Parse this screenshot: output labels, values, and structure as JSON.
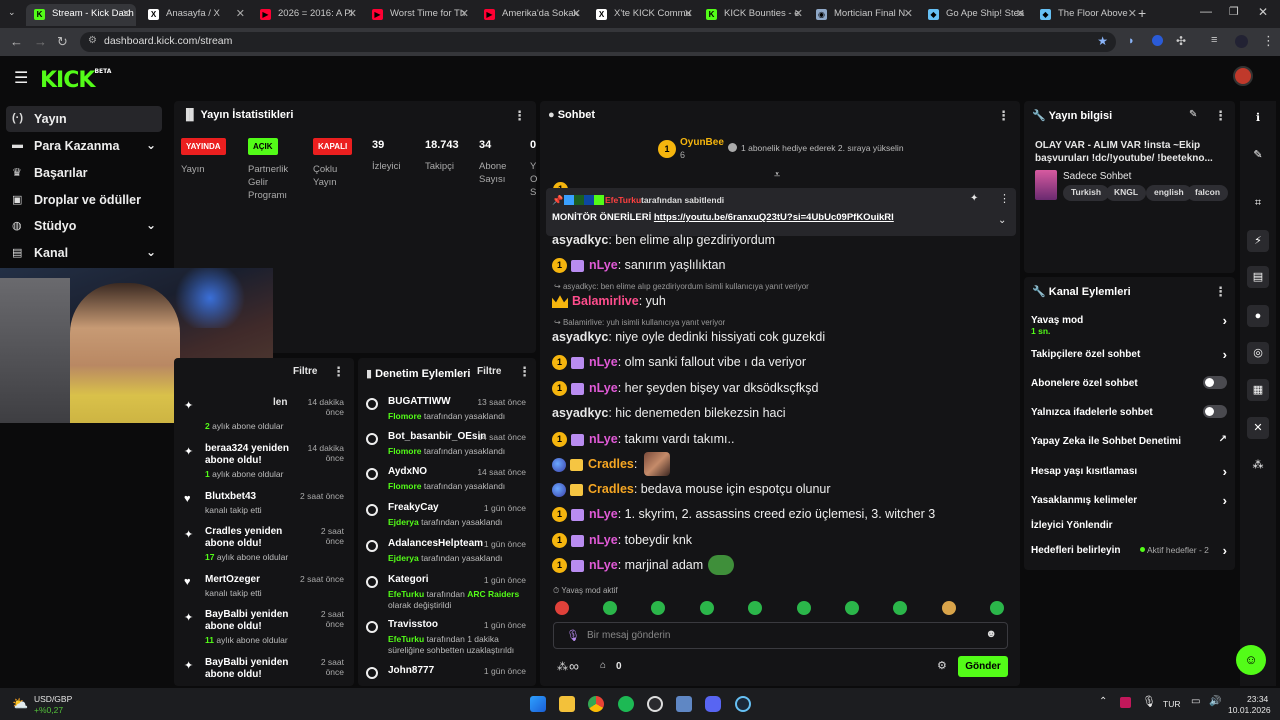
{
  "browser": {
    "tabs": [
      {
        "label": "Stream - Kick Dash",
        "color": "#53fc18",
        "glyph": "K"
      },
      {
        "label": "Anasayfa / X",
        "color": "#ffffff",
        "glyph": "X"
      },
      {
        "label": "2026 = 2016: A Pl",
        "color": "#ff0033",
        "glyph": "▶"
      },
      {
        "label": "Worst Time for Th",
        "color": "#ff0033",
        "glyph": "▶"
      },
      {
        "label": "Amerika'da Sokak",
        "color": "#ff0033",
        "glyph": "▶"
      },
      {
        "label": "X'te KICK Commu",
        "color": "#ffffff",
        "glyph": "X"
      },
      {
        "label": "KICK Bounties - e",
        "color": "#53fc18",
        "glyph": "K"
      },
      {
        "label": "Mortician Final N",
        "color": "#8fa8c8",
        "glyph": "◉"
      },
      {
        "label": "Go Ape Ship! Stea",
        "color": "#66c0f4",
        "glyph": "◆"
      },
      {
        "label": "The Floor Above",
        "color": "#66c0f4",
        "glyph": "◆"
      }
    ],
    "url": "dashboard.kick.com/stream"
  },
  "kick": {
    "logo": "KICK",
    "beta": "BETA"
  },
  "sidebar": {
    "items": [
      {
        "label": "Yayın",
        "icon": "broadcast-icon",
        "glyph": "(·)"
      },
      {
        "label": "Para Kazanma",
        "icon": "money-icon",
        "glyph": "▬"
      },
      {
        "label": "Başarılar",
        "icon": "trophy-icon",
        "glyph": "♛"
      },
      {
        "label": "Droplar ve ödüller",
        "icon": "gift-icon",
        "glyph": "▣"
      },
      {
        "label": "Stüdyo",
        "icon": "studio-icon",
        "glyph": "◍"
      },
      {
        "label": "Kanal",
        "icon": "channel-icon",
        "glyph": "▤"
      }
    ]
  },
  "stats": {
    "title": "Yayın İstatistikleri",
    "badges": [
      {
        "value": "YAYINDA",
        "label": "Yayın",
        "bg": "#eb1f1f",
        "fg": "#ffffff"
      },
      {
        "value": "AÇIK",
        "label": "Partnerlik\nGelir\nProgramı",
        "bg": "#53fc18",
        "fg": "#000000"
      },
      {
        "value": "KAPALI",
        "label": "Çoklu\nYayın",
        "bg": "#eb1f1f",
        "fg": "#ffffff"
      }
    ],
    "numbers": [
      {
        "value": "39",
        "label": "İzleyici"
      },
      {
        "value": "18.743",
        "label": "Takipçi"
      },
      {
        "value": "34",
        "label": "Abone\nSayısı"
      },
      {
        "value": "0",
        "label": "Y\nO\nS"
      }
    ]
  },
  "events": {
    "filter": "Filtre",
    "items": [
      {
        "icon": "sparkle-icon",
        "name": "",
        "time": "14 dakika\nönce",
        "sub_b": "2",
        "sub": " aylık abone oldular"
      },
      {
        "icon": "sparkle-icon",
        "name": "beraa324 yeniden\nabone oldu!",
        "time": "14 dakika\nönce",
        "sub_b": "1",
        "sub": " aylık abone oldular"
      },
      {
        "icon": "heart-icon",
        "name": "Blutxbet43",
        "time": "2 saat önce",
        "sub_b": "",
        "sub": "kanalı takip etti"
      },
      {
        "icon": "sparkle-icon",
        "name": "Cradles yeniden\nabone oldu!",
        "time": "2 saat\nönce",
        "sub_b": "17",
        "sub": " aylık abone oldular"
      },
      {
        "icon": "heart-icon",
        "name": "MertOzeger",
        "time": "2 saat önce",
        "sub_b": "",
        "sub": "kanalı takip etti"
      },
      {
        "icon": "sparkle-icon",
        "name": "BayBalbi yeniden\nabone oldu!",
        "time": "2 saat\nönce",
        "sub_b": "11",
        "sub": " aylık abone oldular"
      },
      {
        "icon": "sparkle-icon",
        "name": "BayBalbi yeniden\nabone oldu!",
        "time": "2 saat\nönce",
        "sub_b": "",
        "sub": ""
      }
    ],
    "partial_name": "len"
  },
  "mod": {
    "title": "Denetim Eylemleri",
    "filter": "Filtre",
    "items": [
      {
        "name": "BUGATTIWW",
        "time": "13 saat önce",
        "actor": "Flomore",
        "text": " tarafından yasaklandı"
      },
      {
        "name": "Bot_basanbir_OEsin",
        "time": "14 saat önce",
        "actor": "Flomore",
        "text": " tarafından yasaklandı"
      },
      {
        "name": "AydxNO",
        "time": "14 saat önce",
        "actor": "Flomore",
        "text": " tarafından yasaklandı"
      },
      {
        "name": "FreakyCay",
        "time": "1 gün önce",
        "actor": "Ejderya",
        "text": " tarafından yasaklandı"
      },
      {
        "name": "AdalancesHelpteam",
        "time": "1 gün önce",
        "actor": "Ejderya",
        "text": " tarafından yasaklandı"
      },
      {
        "name": "Kategori",
        "time": "1 gün önce",
        "actor": "EfeTurku",
        "text": " tarafından ",
        "extra": "ARC Raiders",
        "tail": "olarak değiştirildi"
      },
      {
        "name": "Travisstoo",
        "time": "1 gün önce",
        "actor": "EfeTurku",
        "text": " tarafından 1 dakika süreliğine sohbetten uzaklaştırıldı"
      },
      {
        "name": "John8777",
        "time": "1 gün önce",
        "actor": "",
        "text": ""
      }
    ]
  },
  "chat": {
    "title": "Sohbet",
    "top_gifter": {
      "name": "OyunBee",
      "count": "6",
      "rank": "1"
    },
    "gift_text": "1 abonelik hediye ederek 2. sıraya yükselin",
    "pinned_by": "EfeTurku",
    "pinned_label": "tarafından sabitlendi",
    "pinned_text": "MONİTÖR ÖNERİLERİ",
    "pinned_link": "https://youtu.be/6ranxuQ23tU?si=4UbUc09PfKOuikRl",
    "messages": [
      {
        "user": "asyadkyc",
        "color": "#e7e7e7",
        "text": ": ben elime alıp gezdiriyordum",
        "coin": false,
        "sub": false
      },
      {
        "user": "nLye",
        "color": "#e05ad6",
        "text": ": sanırım yaşlılıktan",
        "coin": true,
        "sub": true
      },
      {
        "user": "Balamirlive",
        "color": "#ff4d8d",
        "text": ": yuh",
        "coin": false,
        "sub": false,
        "crown": true
      },
      {
        "user": "asyadkyc",
        "color": "#e7e7e7",
        "text": ": niye oyle dedinki hissiyati cok guzekdi",
        "coin": false,
        "sub": false
      },
      {
        "user": "nLye",
        "color": "#e05ad6",
        "text": ": olm sanki fallout vibe ı da veriyor",
        "coin": true,
        "sub": true
      },
      {
        "user": "nLye",
        "color": "#e05ad6",
        "text": ": her şeyden bişey var dksödksçfkşd",
        "coin": true,
        "sub": true
      },
      {
        "user": "asyadkyc",
        "color": "#e7e7e7",
        "text": ": hic denemeden bilekezsin haci",
        "coin": false,
        "sub": false
      },
      {
        "user": "nLye",
        "color": "#e05ad6",
        "text": ": takımı vardı takımı..",
        "coin": true,
        "sub": true
      },
      {
        "user": "Cradles",
        "color": "#f5a623",
        "text": ":",
        "coin": false,
        "sub": false,
        "globe": true
      },
      {
        "user": "Cradles",
        "color": "#f5a623",
        "text": ": bedava mouse için espotçu olunur",
        "coin": false,
        "sub": false,
        "globe": true
      },
      {
        "user": "nLye",
        "color": "#e05ad6",
        "text": ": 1. skyrim, 2. assassins creed ezio üçlemesi, 3. witcher 3",
        "coin": true,
        "sub": true
      },
      {
        "user": "nLye",
        "color": "#e05ad6",
        "text": ": tobeydir knk",
        "coin": true,
        "sub": true
      },
      {
        "user": "nLye",
        "color": "#e05ad6",
        "text": ": marjinal adam",
        "coin": true,
        "sub": true
      }
    ],
    "replies": [
      "asyadkyc: ben elime alıp gezdiriyordum isimli kullanıcıya yanıt veriyor",
      "Balamirlive: yuh isimli kullanıcıya yanıt veriyor"
    ],
    "slow_mode": "Yavaş mod aktif",
    "input_placeholder": "Bir mesaj gönderin",
    "send": "Gönder",
    "points": "0",
    "infinity": "∞"
  },
  "stream_info": {
    "title": "Yayın bilgisi",
    "stream_title": "OLAY VAR - ALIM VAR !insta ~Ekip başvuruları !dc/!youtube/ !beetekno...",
    "category": "Sadece Sohbet",
    "tags": [
      "Turkish",
      "KNGL",
      "english",
      "falcon"
    ]
  },
  "channel_actions": {
    "title": "Kanal Eylemleri",
    "items": [
      {
        "label": "Yavaş mod",
        "sub": "1 sn.",
        "control": "chevron"
      },
      {
        "label": "Takipçilere özel sohbet",
        "sub": "",
        "control": "chevron"
      },
      {
        "label": "Abonelere özel sohbet",
        "sub": "",
        "control": "toggle"
      },
      {
        "label": "Yalnızca ifadelerle sohbet",
        "sub": "",
        "control": "toggle"
      },
      {
        "label": "Yapay Zeka ile Sohbet Denetimi",
        "sub": "",
        "control": "external"
      },
      {
        "label": "Hesap yaşı kısıtlaması",
        "sub": "",
        "control": "chevron"
      },
      {
        "label": "Yasaklanmış kelimeler",
        "sub": "",
        "control": "chevron"
      },
      {
        "label": "İzleyici Yönlendir",
        "sub": "",
        "control": "none"
      },
      {
        "label": "Hedefleri belirleyin",
        "sub": "",
        "control": "chevron",
        "status": "Aktif hedefler - 2"
      }
    ]
  },
  "taskbar": {
    "stock": "USD/GBP",
    "stock_change": "+%0,27",
    "lang": "TUR",
    "time": "23:34",
    "date": "10.01.2026"
  },
  "colors": {
    "accent": "#53fc18",
    "panel": "#141416",
    "live": "#eb1f1f"
  }
}
